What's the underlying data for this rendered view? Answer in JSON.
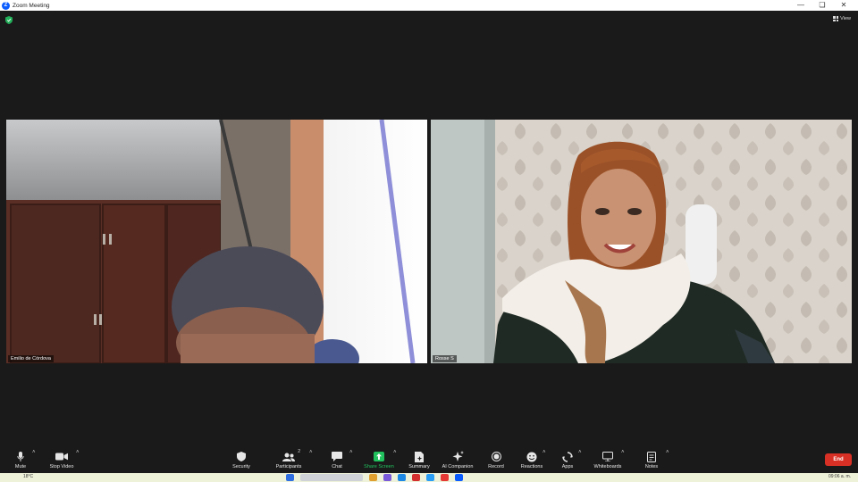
{
  "window": {
    "title": "Zoom Meeting"
  },
  "header": {
    "view_label": "View"
  },
  "participants_tiles": [
    {
      "name": "Emilio de Córdova"
    },
    {
      "name": "Rosse S"
    }
  ],
  "toolbar": {
    "mute": "Mute",
    "stop_video": "Stop Video",
    "security": "Security",
    "participants": "Participants",
    "participants_count": "2",
    "chat": "Chat",
    "share_screen": "Share Screen",
    "summary": "Summary",
    "ai_companion": "AI Companion",
    "record": "Record",
    "reactions": "Reactions",
    "apps": "Apps",
    "whiteboards": "Whiteboards",
    "notes": "Notes",
    "end": "End"
  },
  "taskbar": {
    "temperature": "18°C",
    "clock": "09:06 a. m."
  },
  "colors": {
    "accent": "#0b5cff",
    "share_green": "#21c25e",
    "end_red": "#d93025"
  }
}
